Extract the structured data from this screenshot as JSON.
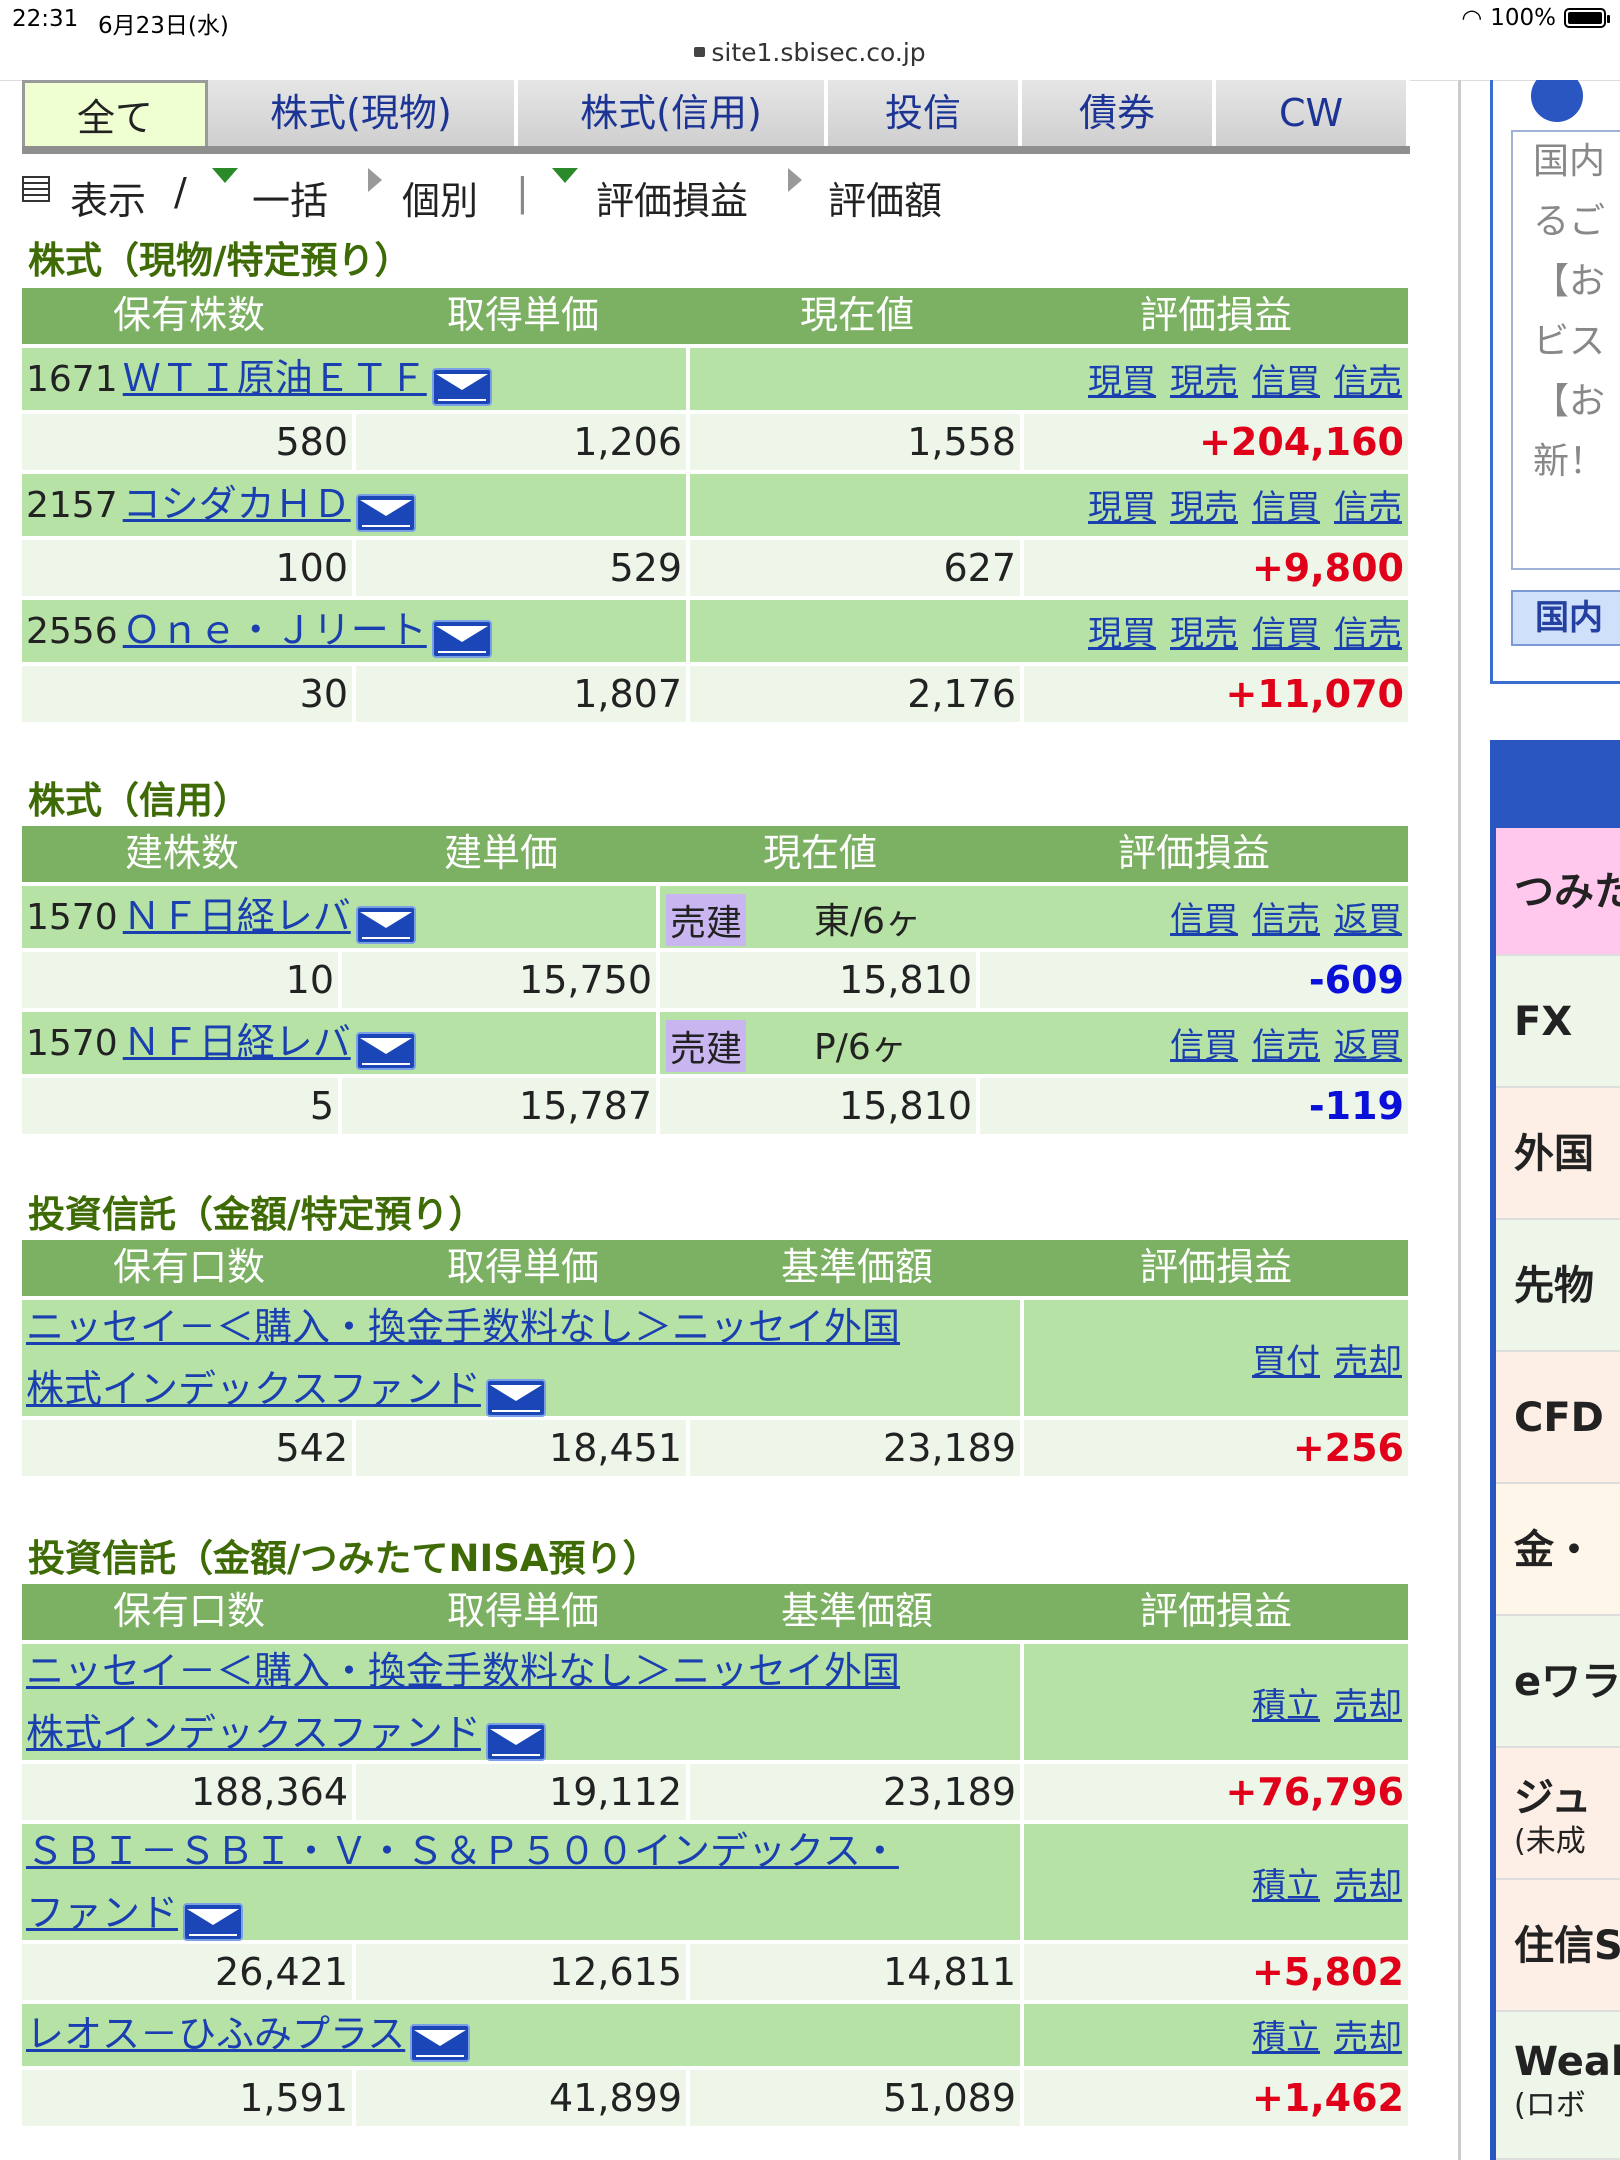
{
  "status": {
    "time": "22:31",
    "date": "6月23日(水)",
    "battery": "100%"
  },
  "url": "site1.sbisec.co.jp",
  "tabs": [
    "全て",
    "株式(現物)",
    "株式(信用)",
    "投信",
    "債券",
    "CW"
  ],
  "toolbar": {
    "display": "表示",
    "slash": "/",
    "bulk": "一括",
    "individual": "個別",
    "pipe": "|",
    "pl": "評価損益",
    "value": "評価額"
  },
  "actions": {
    "buy_cash": "現買",
    "sell_cash": "現売",
    "buy_margin": "信買",
    "sell_margin": "信売",
    "repay": "返買",
    "purchase": "買付",
    "sell": "売却",
    "accumulate": "積立"
  },
  "spot": {
    "title": "株式（現物/特定預り）",
    "headers": [
      "保有株数",
      "取得単価",
      "現在値",
      "評価損益"
    ],
    "rows": [
      {
        "code": "1671",
        "name": "ＷＴＩ原油ＥＴＦ",
        "qty": "580",
        "cost": "1,206",
        "price": "1,558",
        "pl": "+204,160"
      },
      {
        "code": "2157",
        "name": "コシダカＨＤ",
        "qty": "100",
        "cost": "529",
        "price": "627",
        "pl": "+9,800"
      },
      {
        "code": "2556",
        "name": "Ｏｎｅ・Ｊリート",
        "qty": "30",
        "cost": "1,807",
        "price": "2,176",
        "pl": "+11,070"
      }
    ]
  },
  "margin": {
    "title": "株式（信用）",
    "headers": [
      "建株数",
      "建単価",
      "現在値",
      "評価損益"
    ],
    "rows": [
      {
        "code": "1570",
        "name": "ＮＦ日経レバ",
        "type": "売建",
        "market": "東/6ヶ",
        "qty": "10",
        "cost": "15,750",
        "price": "15,810",
        "pl": "-609"
      },
      {
        "code": "1570",
        "name": "ＮＦ日経レバ",
        "type": "売建",
        "market": "P/6ヶ",
        "qty": "5",
        "cost": "15,787",
        "price": "15,810",
        "pl": "-119"
      }
    ]
  },
  "fund": {
    "title": "投資信託（金額/特定預り）",
    "headers": [
      "保有口数",
      "取得単価",
      "基準価額",
      "評価損益"
    ],
    "rows": [
      {
        "name1": "ニッセイ－＜購入・換金手数料なし＞ニッセイ外国",
        "name2": "株式インデックスファンド",
        "qty": "542",
        "cost": "18,451",
        "price": "23,189",
        "pl": "+256"
      }
    ]
  },
  "nisa": {
    "title": "投資信託（金額/つみたてNISA預り）",
    "headers": [
      "保有口数",
      "取得単価",
      "基準価額",
      "評価損益"
    ],
    "rows": [
      {
        "name1": "ニッセイ－＜購入・換金手数料なし＞ニッセイ外国",
        "name2": "株式インデックスファンド",
        "qty": "188,364",
        "cost": "19,112",
        "price": "23,189",
        "pl": "+76,796"
      },
      {
        "name1": "ＳＢＩ－ＳＢＩ・Ｖ・Ｓ＆Ｐ５００インデックス・",
        "name2": "ファンド",
        "qty": "26,421",
        "cost": "12,615",
        "price": "14,811",
        "pl": "+5,802"
      },
      {
        "name1": "レオス－ひふみプラス",
        "qty": "1,591",
        "cost": "41,899",
        "price": "51,089",
        "pl": "+1,462"
      }
    ]
  },
  "side": {
    "info_lines": [
      "国内",
      "るご",
      "【お",
      "ビス",
      "【お",
      "新！"
    ],
    "nav_label": "国内",
    "menu": [
      "つみた",
      "FX",
      "外国",
      "先物",
      "CFD",
      "金・",
      "eワラ",
      "ジュ",
      "住信S",
      "Weal"
    ],
    "menu_sub": {
      "ジュ": "(未成",
      "Weal": "(ロボ"
    }
  }
}
